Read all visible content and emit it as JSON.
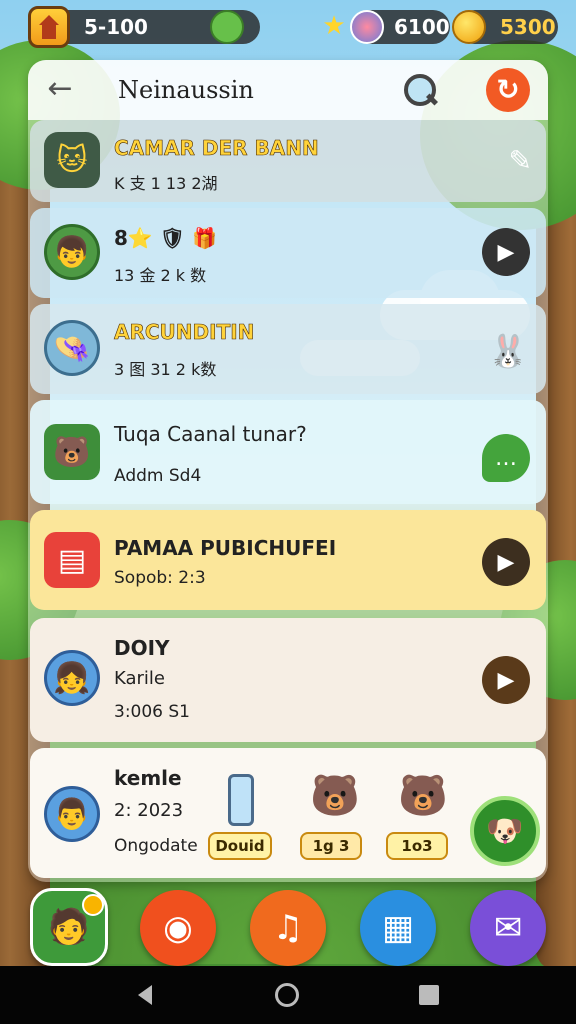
{
  "topbar": {
    "left_counter": "5-100",
    "gem_value": "6100",
    "coin_value": "5300"
  },
  "header": {
    "title": "Neinaussin"
  },
  "rows": [
    {
      "title": "CAMAR DER BANN",
      "subtitle": "K 支 1 13 2湖"
    },
    {
      "title": "8⭐ 🛡 🎁",
      "subtitle": "13 金 2 k 数"
    },
    {
      "title": "ARCUNDITIN",
      "subtitle": "3 图 31 2 k数"
    },
    {
      "title": "Tuqa Caanal tunar?",
      "subtitle": "Addm Sd4"
    },
    {
      "title": "PAMAA PUBICHUFEI",
      "subtitle": "Sopob: 2:3"
    },
    {
      "title": "DOIY",
      "subtitle": "Karile",
      "meta": "3:006 S1"
    },
    {
      "title": "kemle",
      "subtitle": "2: 2023",
      "meta": "Ongodate"
    }
  ],
  "pills": {
    "p1": "Douid",
    "p2": "1g 3",
    "p3": "1o3"
  },
  "colors": {
    "accent_orange": "#f25a24",
    "dark_play": "#3a3a3a",
    "brown_play": "#5a3a1a",
    "green": "#44a43c",
    "purple": "#7a4fd8",
    "blue": "#2a8fe0"
  }
}
